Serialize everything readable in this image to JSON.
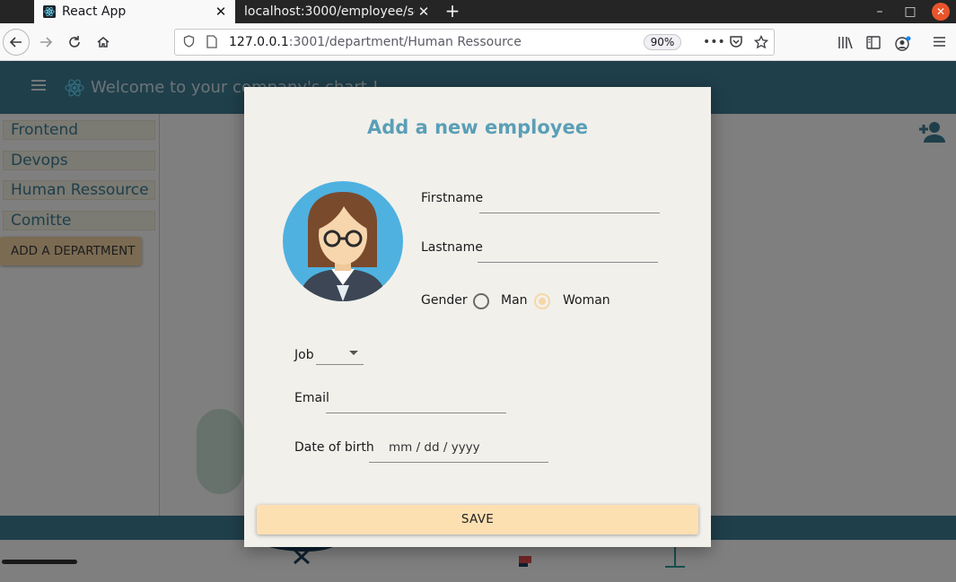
{
  "browser": {
    "tabs": [
      {
        "title": "React App",
        "active": true
      },
      {
        "title": "localhost:3000/employee/se",
        "active": false
      }
    ],
    "new_tab_glyph": "+",
    "url_scheme_host": "127.0.0.1",
    "url_port_path": ":3001/department/Human Ressource",
    "zoom": "90%",
    "window_controls": {
      "minimize": "–",
      "maximize": "□",
      "close": "✕"
    }
  },
  "app": {
    "header_title": "Welcome to your company's chart !",
    "brand_color": "#3f7e96",
    "accent_color": "#f6d7a7"
  },
  "sidebar": {
    "departments": [
      "Frontend",
      "Devops",
      "Human Ressource",
      "Comitte"
    ],
    "add_department_label": "ADD A DEPARTMENT"
  },
  "modal": {
    "title": "Add a new employee",
    "firstname_label": "Firstname",
    "firstname_value": "",
    "lastname_label": "Lastname",
    "lastname_value": "",
    "gender_label": "Gender",
    "gender_options": [
      {
        "label": "Man",
        "selected": false
      },
      {
        "label": "Woman",
        "selected": true
      }
    ],
    "job_label": "Job",
    "job_value": "",
    "email_label": "Email",
    "email_value": "",
    "dob_label": "Date of birth",
    "dob_placeholder": "mm / dd / yyyy",
    "save_label": "SAVE"
  }
}
